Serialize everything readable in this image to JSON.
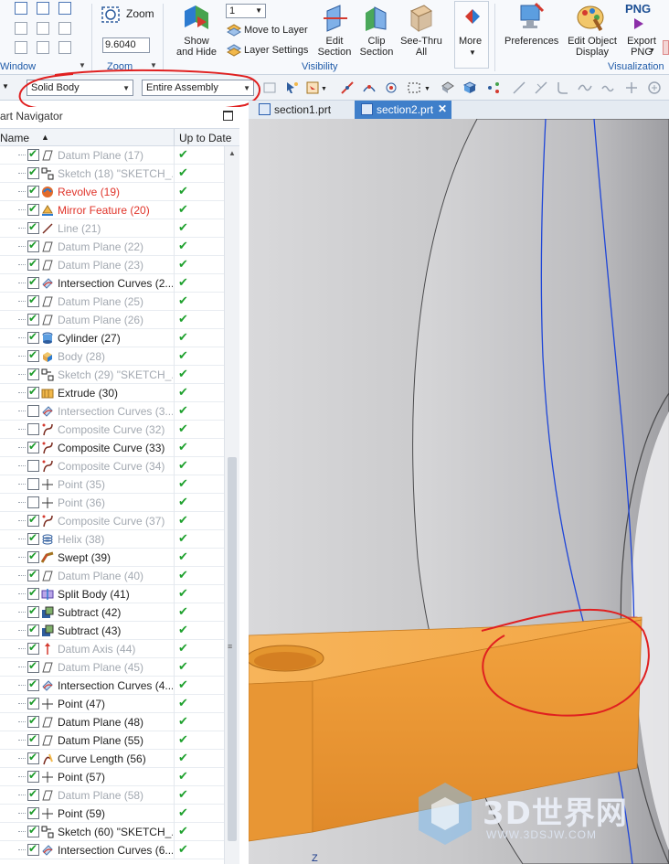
{
  "ribbon": {
    "window_group_label": "Window",
    "zoom_label": "Zoom",
    "zoom_value": "9.6040",
    "zoom_group_label": "Zoom",
    "show_hide_label": "Show\nand Hide",
    "layer_value": "1",
    "move_to_layer": "Move to Layer",
    "layer_settings": "Layer Settings",
    "edit_section": "Edit\nSection",
    "clip_section": "Clip\nSection",
    "see_thru": "See-Thru\nAll",
    "more": "More",
    "visibility_group_label": "Visibility",
    "preferences": "Preferences",
    "edit_object_display": "Edit Object\nDisplay",
    "png_badge": "PNG",
    "export_png": "Export\nPNG",
    "visualization_group_label": "Visualization"
  },
  "selection": {
    "type_filter": "Solid Body",
    "scope": "Entire Assembly"
  },
  "navigator": {
    "title": "art Navigator",
    "col_name": "Name",
    "col_status": "Up to Date",
    "rows": [
      {
        "label": "Datum Plane (17)",
        "icon": "datum-plane-icon",
        "checked": true,
        "state": "dim"
      },
      {
        "label": "Sketch (18) \"SKETCH_...",
        "icon": "sketch-icon",
        "checked": true,
        "state": "dim"
      },
      {
        "label": "Revolve (19)",
        "icon": "revolve-icon",
        "checked": true,
        "state": "red"
      },
      {
        "label": "Mirror Feature (20)",
        "icon": "mirror-icon",
        "checked": true,
        "state": "red"
      },
      {
        "label": "Line (21)",
        "icon": "line-icon",
        "checked": true,
        "state": "dim"
      },
      {
        "label": "Datum Plane (22)",
        "icon": "datum-plane-icon",
        "checked": true,
        "state": "dim"
      },
      {
        "label": "Datum Plane (23)",
        "icon": "datum-plane-icon",
        "checked": true,
        "state": "dim"
      },
      {
        "label": "Intersection Curves (2...",
        "icon": "intersection-curves-icon",
        "checked": true,
        "state": "normal"
      },
      {
        "label": "Datum Plane (25)",
        "icon": "datum-plane-icon",
        "checked": true,
        "state": "dim"
      },
      {
        "label": "Datum Plane (26)",
        "icon": "datum-plane-icon",
        "checked": true,
        "state": "dim"
      },
      {
        "label": "Cylinder (27)",
        "icon": "cylinder-icon",
        "checked": true,
        "state": "normal"
      },
      {
        "label": "Body (28)",
        "icon": "body-icon",
        "checked": true,
        "state": "dim"
      },
      {
        "label": "Sketch (29) \"SKETCH_...",
        "icon": "sketch-icon",
        "checked": true,
        "state": "dim"
      },
      {
        "label": "Extrude (30)",
        "icon": "extrude-icon",
        "checked": true,
        "state": "normal"
      },
      {
        "label": "Intersection Curves (3...",
        "icon": "intersection-curves-icon",
        "checked": false,
        "state": "dim"
      },
      {
        "label": "Composite Curve (32)",
        "icon": "composite-curve-icon",
        "checked": false,
        "state": "dim"
      },
      {
        "label": "Composite Curve (33)",
        "icon": "composite-curve-icon",
        "checked": true,
        "state": "normal"
      },
      {
        "label": "Composite Curve (34)",
        "icon": "composite-curve-icon",
        "checked": false,
        "state": "dim"
      },
      {
        "label": "Point (35)",
        "icon": "point-icon",
        "checked": false,
        "state": "dim"
      },
      {
        "label": "Point (36)",
        "icon": "point-icon",
        "checked": false,
        "state": "dim"
      },
      {
        "label": "Composite Curve (37)",
        "icon": "composite-curve-icon",
        "checked": true,
        "state": "dim"
      },
      {
        "label": "Helix (38)",
        "icon": "helix-icon",
        "checked": true,
        "state": "dim"
      },
      {
        "label": "Swept (39)",
        "icon": "swept-icon",
        "checked": true,
        "state": "normal"
      },
      {
        "label": "Datum Plane (40)",
        "icon": "datum-plane-icon",
        "checked": true,
        "state": "dim"
      },
      {
        "label": "Split Body (41)",
        "icon": "split-body-icon",
        "checked": true,
        "state": "normal"
      },
      {
        "label": "Subtract (42)",
        "icon": "subtract-icon",
        "checked": true,
        "state": "normal"
      },
      {
        "label": "Subtract (43)",
        "icon": "subtract-icon",
        "checked": true,
        "state": "normal"
      },
      {
        "label": "Datum Axis (44)",
        "icon": "datum-axis-icon",
        "checked": true,
        "state": "dim"
      },
      {
        "label": "Datum Plane (45)",
        "icon": "datum-plane-icon",
        "checked": true,
        "state": "dim"
      },
      {
        "label": "Intersection Curves (4...",
        "icon": "intersection-curves-icon",
        "checked": true,
        "state": "normal"
      },
      {
        "label": "Point (47)",
        "icon": "point-icon",
        "checked": true,
        "state": "normal"
      },
      {
        "label": "Datum Plane (48)",
        "icon": "datum-plane-icon",
        "checked": true,
        "state": "normal"
      },
      {
        "label": "Datum Plane (55)",
        "icon": "datum-plane-icon",
        "checked": true,
        "state": "normal"
      },
      {
        "label": "Curve Length (56)",
        "icon": "curve-length-icon",
        "checked": true,
        "state": "normal"
      },
      {
        "label": "Point (57)",
        "icon": "point-icon",
        "checked": true,
        "state": "normal"
      },
      {
        "label": "Datum Plane (58)",
        "icon": "datum-plane-icon",
        "checked": true,
        "state": "dim"
      },
      {
        "label": "Point (59)",
        "icon": "point-icon",
        "checked": true,
        "state": "normal"
      },
      {
        "label": "Sketch (60) \"SKETCH_...",
        "icon": "sketch-icon",
        "checked": true,
        "state": "normal"
      },
      {
        "label": "Intersection Curves (6...",
        "icon": "intersection-curves-icon",
        "checked": true,
        "state": "normal"
      }
    ]
  },
  "tabs": [
    {
      "label": "section1.prt",
      "active": false
    },
    {
      "label": "section2.prt",
      "active": true
    }
  ],
  "viewport": {
    "axis_label": "Z",
    "watermark_name": "3D世界网",
    "watermark_url": "WWW.3DSJW.COM"
  },
  "colors": {
    "accent": "#3f7fca",
    "ok_green": "#1fa12e",
    "modified_red": "#e0342a",
    "body_orange": "#f0a040",
    "annotation_red": "#e02020"
  }
}
